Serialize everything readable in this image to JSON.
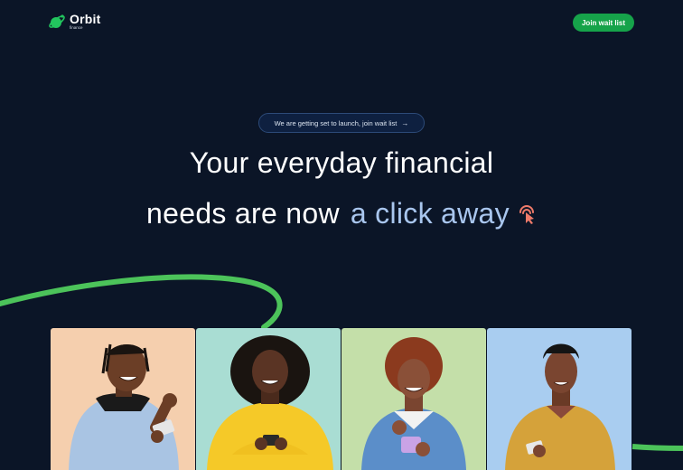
{
  "brand": {
    "name": "Orbit",
    "subname": "finance"
  },
  "nav": {
    "cta_label": "Join wait list"
  },
  "announcement": {
    "text": "We are getting set to launch, join wait list",
    "icon": "arrow-right-icon"
  },
  "hero": {
    "line1": "Your everyday financial",
    "line2_plain": "needs are now",
    "line2_accent": "a click away",
    "icon": "pointer-click-icon"
  },
  "colors": {
    "background": "#0b1527",
    "accent_green": "#16a34a",
    "swoosh_green": "#4cc35a",
    "accent_blue_text": "#a9c6ee",
    "card_bg_1": "#f5cfae",
    "card_bg_2": "#a9ddd3",
    "card_bg_3": "#c4dfa9",
    "card_bg_4": "#a9cdf0"
  },
  "cards": [
    {
      "subject": "person-celebrating-with-phone"
    },
    {
      "subject": "person-in-yellow-sweater-with-phone"
    },
    {
      "subject": "person-smiling-at-phone"
    },
    {
      "subject": "person-in-mustard-sweater-with-phone"
    }
  ]
}
